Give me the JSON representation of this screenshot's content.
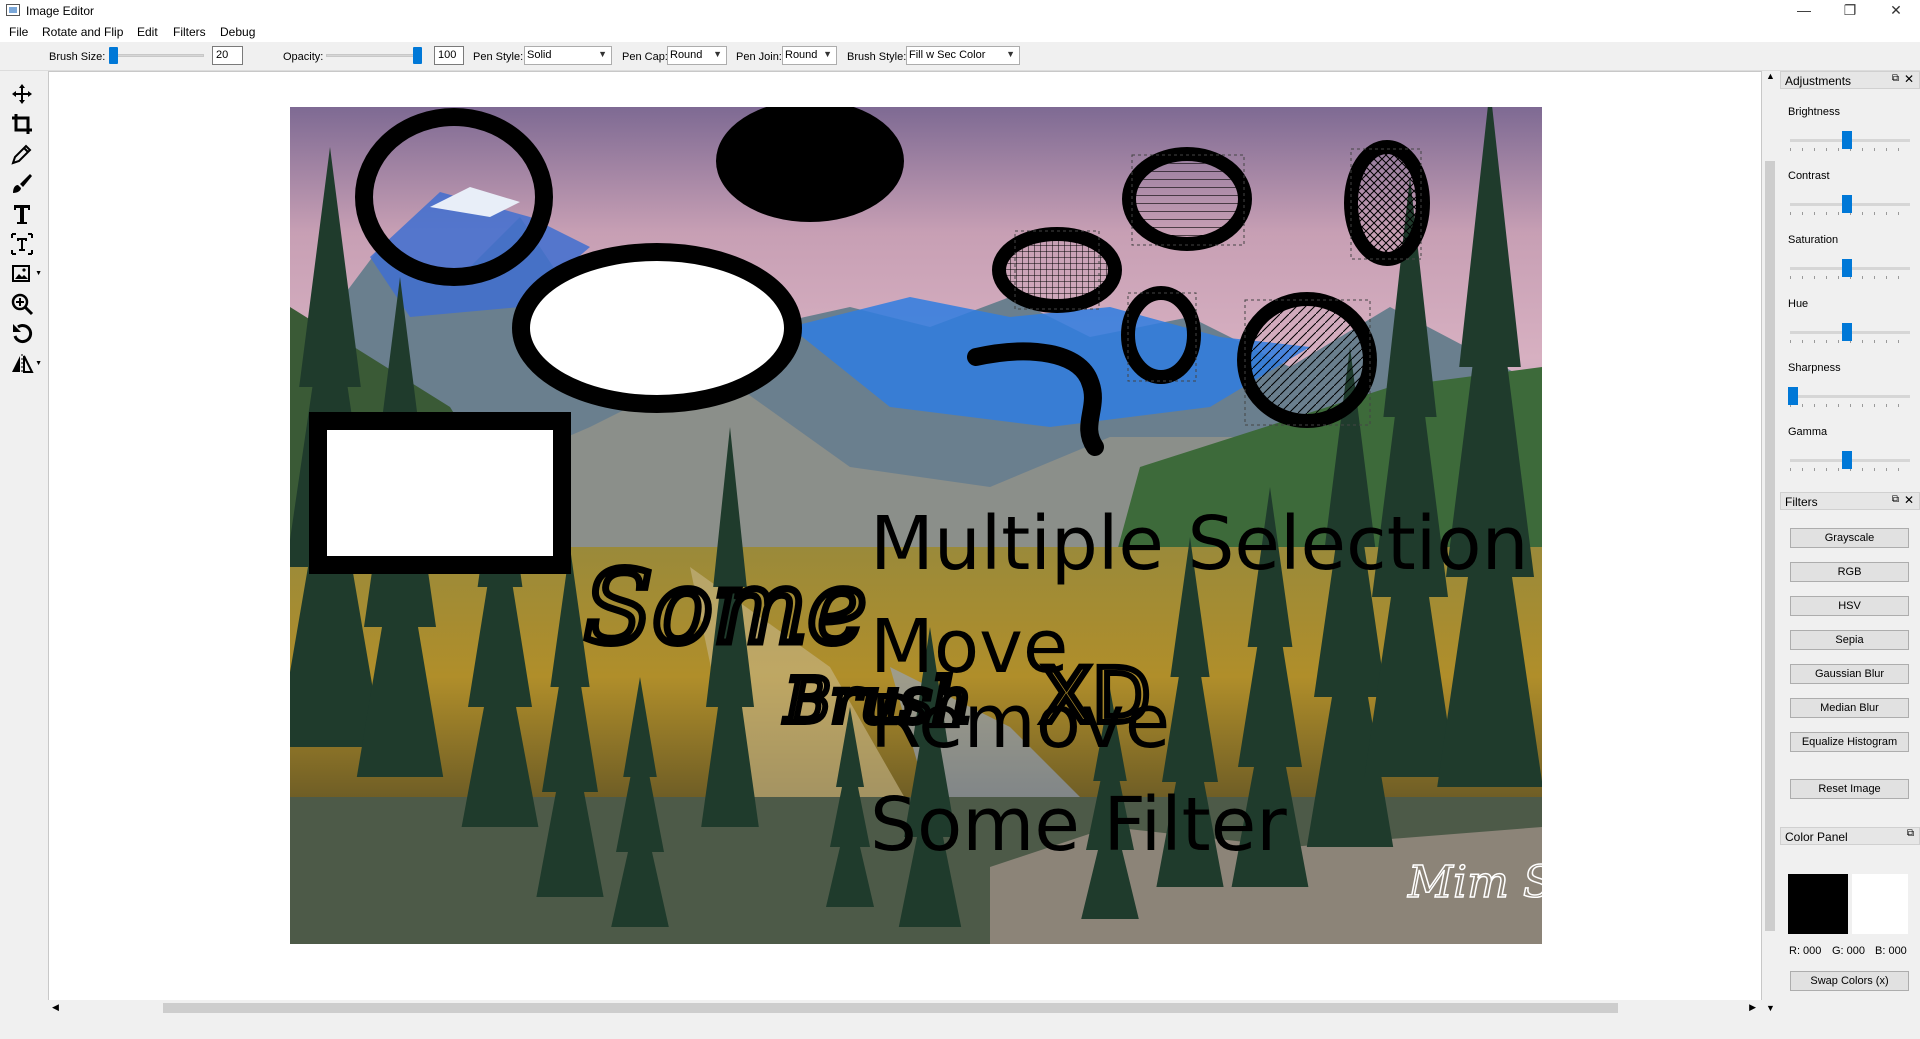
{
  "window": {
    "title": "Image Editor",
    "minimize": "—",
    "maximize": "❐",
    "close": "✕"
  },
  "menu": [
    "File",
    "Rotate and Flip",
    "Edit",
    "Filters",
    "Debug"
  ],
  "toolbar": {
    "brush_size_label": "Brush Size:",
    "brush_size_value": "20",
    "opacity_label": "Opacity:",
    "opacity_value": "100",
    "pen_style_label": "Pen Style:",
    "pen_style_value": "Solid",
    "pen_cap_label": "Pen Cap:",
    "pen_cap_value": "Round",
    "pen_join_label": "Pen Join:",
    "pen_join_value": "Round",
    "brush_style_label": "Brush Style:",
    "brush_style_value": "Fill w Sec Color"
  },
  "tools": [
    "move-icon",
    "crop-icon",
    "pencil-icon",
    "brush-icon",
    "text-icon",
    "text-box-icon",
    "image-insert-icon",
    "zoom-icon",
    "undo-icon",
    "flip-icon"
  ],
  "canvas_text": {
    "line1": "Multiple Selection",
    "line2": "Move",
    "line3": "Remove",
    "line4": "Some Filter",
    "handwritten1": "Some",
    "handwritten2": "Brush",
    "handwritten3": "XD",
    "signature": "Mim S"
  },
  "adjustments": {
    "title": "Adjustments",
    "sliders": [
      {
        "label": "Brightness",
        "value": 0.5
      },
      {
        "label": "Contrast",
        "value": 0.5
      },
      {
        "label": "Saturation",
        "value": 0.5
      },
      {
        "label": "Hue",
        "value": 0.5
      },
      {
        "label": "Sharpness",
        "value": 0.0
      },
      {
        "label": "Gamma",
        "value": 0.5
      }
    ]
  },
  "filters": {
    "title": "Filters",
    "buttons": [
      "Grayscale",
      "RGB",
      "HSV",
      "Sepia",
      "Gaussian Blur",
      "Median Blur",
      "Equalize Histogram"
    ],
    "reset": "Reset Image"
  },
  "color_panel": {
    "title": "Color Panel",
    "primary": "#000000",
    "secondary": "#ffffff",
    "r": "R: 000",
    "g": "G: 000",
    "b": "B: 000",
    "swap": "Swap Colors (x)"
  },
  "colors": {
    "accent": "#0078d7"
  }
}
